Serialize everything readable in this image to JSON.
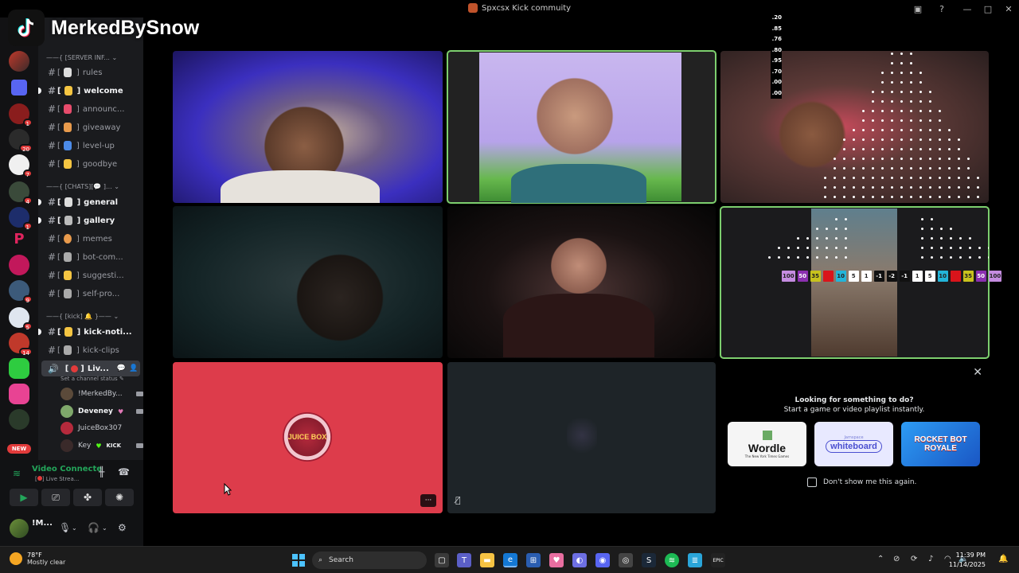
{
  "window": {
    "title": "Spxcsx Kick commuity"
  },
  "watermark": {
    "username": "MerkedBySnow"
  },
  "rail": {
    "badges": [
      "1",
      "20",
      "7",
      "4",
      "1",
      "9",
      "5",
      "14"
    ],
    "new_label": "NEW"
  },
  "channels": {
    "categories": {
      "server_info": "[SERVER INF...",
      "chats": "[CHATS][💬 ]...",
      "kick": "[kick] 🔔"
    },
    "items": [
      {
        "label": "rules"
      },
      {
        "label": "welcome"
      },
      {
        "label": "announc..."
      },
      {
        "label": "giveaway"
      },
      {
        "label": "level-up"
      },
      {
        "label": "goodbye"
      },
      {
        "label": "general"
      },
      {
        "label": "gallery"
      },
      {
        "label": "memes"
      },
      {
        "label": "bot-com..."
      },
      {
        "label": "suggesti..."
      },
      {
        "label": "self-pro..."
      },
      {
        "label": "kick-noti..."
      },
      {
        "label": "kick-clips"
      },
      {
        "label": "Liv..."
      }
    ],
    "voice_status": "Set a channel status",
    "voice_users": [
      {
        "name": "!MerkedBy..."
      },
      {
        "name": "Deveney"
      },
      {
        "name": "JuiceBox307"
      },
      {
        "name": "Key"
      }
    ],
    "kick_badge": "KICK"
  },
  "voice_panel": {
    "title": "Video Connecte",
    "subtitle": "Live Strea..."
  },
  "user_panel": {
    "name": "!M..."
  },
  "stage": {
    "juice_label": "JUICE BOX",
    "number_column": [
      ".20",
      ".85",
      ".76",
      ".80",
      ".95",
      ".70",
      ".00",
      ".00"
    ],
    "score_strip": [
      {
        "v": "100",
        "c": "#c58ce0",
        "fg": "#222"
      },
      {
        "v": "50",
        "c": "#8b2fb0",
        "fg": "#fff"
      },
      {
        "v": "35",
        "c": "#c8c21d",
        "fg": "#222"
      },
      {
        "v": "",
        "c": "#d9141b",
        "fg": "#fff"
      },
      {
        "v": "10",
        "c": "#23b5d9",
        "fg": "#222"
      },
      {
        "v": "5",
        "c": "#ffffff",
        "fg": "#222"
      },
      {
        "v": "1",
        "c": "#ffffff",
        "fg": "#222"
      },
      {
        "v": "-1",
        "c": "#111111",
        "fg": "#fff"
      },
      {
        "v": "-2",
        "c": "#111111",
        "fg": "#fff"
      },
      {
        "v": "-1",
        "c": "#111111",
        "fg": "#fff"
      },
      {
        "v": "1",
        "c": "#ffffff",
        "fg": "#222"
      },
      {
        "v": "5",
        "c": "#ffffff",
        "fg": "#222"
      },
      {
        "v": "10",
        "c": "#23b5d9",
        "fg": "#222"
      },
      {
        "v": "",
        "c": "#d9141b",
        "fg": "#fff"
      },
      {
        "v": "35",
        "c": "#c8c21d",
        "fg": "#222"
      },
      {
        "v": "50",
        "c": "#8b2fb0",
        "fg": "#fff"
      },
      {
        "v": "100",
        "c": "#c58ce0",
        "fg": "#222"
      }
    ]
  },
  "activity": {
    "heading": "Looking for something to do?",
    "subheading": "Start a game or video playlist instantly.",
    "cards": [
      {
        "name": "Wordle",
        "tag": "The New York Times Games"
      },
      {
        "name": "whiteboard",
        "tag": "Jamspace"
      },
      {
        "name": "ROCKET BOT ROYALE",
        "tag": ""
      }
    ],
    "dont_show": "Don't show me this again."
  },
  "taskbar": {
    "temperature": "78°F",
    "condition": "Mostly clear",
    "search_placeholder": "Search",
    "time": "11:39 PM",
    "date": "11/14/2025"
  }
}
